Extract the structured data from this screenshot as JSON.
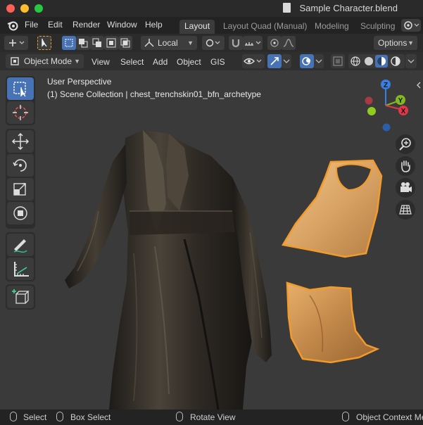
{
  "window": {
    "title": "Sample Character.blend"
  },
  "menubar": {
    "items": [
      "File",
      "Edit",
      "Render",
      "Window",
      "Help"
    ],
    "workspaces": [
      "Layout",
      "Layout Quad (Manual)",
      "Modeling",
      "Sculpting"
    ],
    "active_workspace": "Layout"
  },
  "toolheader": {
    "transform_orientation": "Local",
    "options_label": "Options"
  },
  "viewport_header": {
    "mode": "Object Mode",
    "menus": [
      "View",
      "Select",
      "Add",
      "Object",
      "GIS"
    ]
  },
  "viewport": {
    "view_name": "User Perspective",
    "collection_info": "(1) Scene Collection | chest_trenchskin01_bfn_archetype",
    "gizmo": {
      "x": "X",
      "y": "Y",
      "z": "Z"
    }
  },
  "statusbar": {
    "items": [
      "Select",
      "Box Select",
      "Rotate View",
      "Object Context Menu"
    ]
  },
  "colors": {
    "accent": "#4772b3",
    "selection_outline": "#f29b2c",
    "x_axis": "#e2364a",
    "y_axis": "#82b820",
    "z_axis": "#3a7ee0"
  }
}
